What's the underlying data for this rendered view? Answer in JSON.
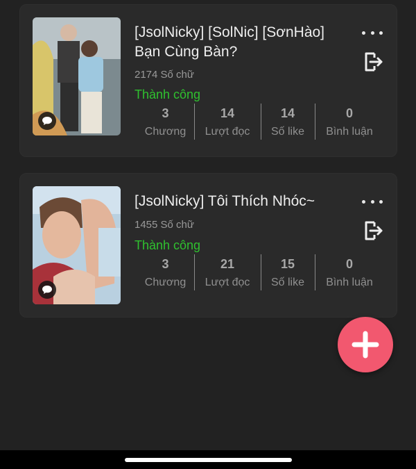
{
  "colors": {
    "background": "#222222",
    "card": "#2a2a2a",
    "status": "#2fc12f",
    "fab": "#f2586f"
  },
  "stories": [
    {
      "title": "[JsolNicky] [SolNic] [SơnHào] Bạn Cùng Bàn?",
      "word_count": "2174 Số chữ",
      "status": "Thành công",
      "stats": [
        {
          "value": "3",
          "label": "Chương"
        },
        {
          "value": "14",
          "label": "Lượt đọc"
        },
        {
          "value": "14",
          "label": "Số like"
        },
        {
          "value": "0",
          "label": "Bình luận"
        }
      ],
      "icons": {
        "more": "more-horizontal-icon",
        "exit": "exit-icon",
        "comment": "comment-bubble-icon"
      }
    },
    {
      "title": "[JsolNicky] Tôi Thích Nhóc~",
      "word_count": "1455 Số chữ",
      "status": "Thành công",
      "stats": [
        {
          "value": "3",
          "label": "Chương"
        },
        {
          "value": "21",
          "label": "Lượt đọc"
        },
        {
          "value": "15",
          "label": "Số like"
        },
        {
          "value": "0",
          "label": "Bình luận"
        }
      ],
      "icons": {
        "more": "more-horizontal-icon",
        "exit": "exit-icon",
        "comment": "comment-bubble-icon"
      }
    }
  ],
  "fab": {
    "icon": "plus-icon"
  }
}
